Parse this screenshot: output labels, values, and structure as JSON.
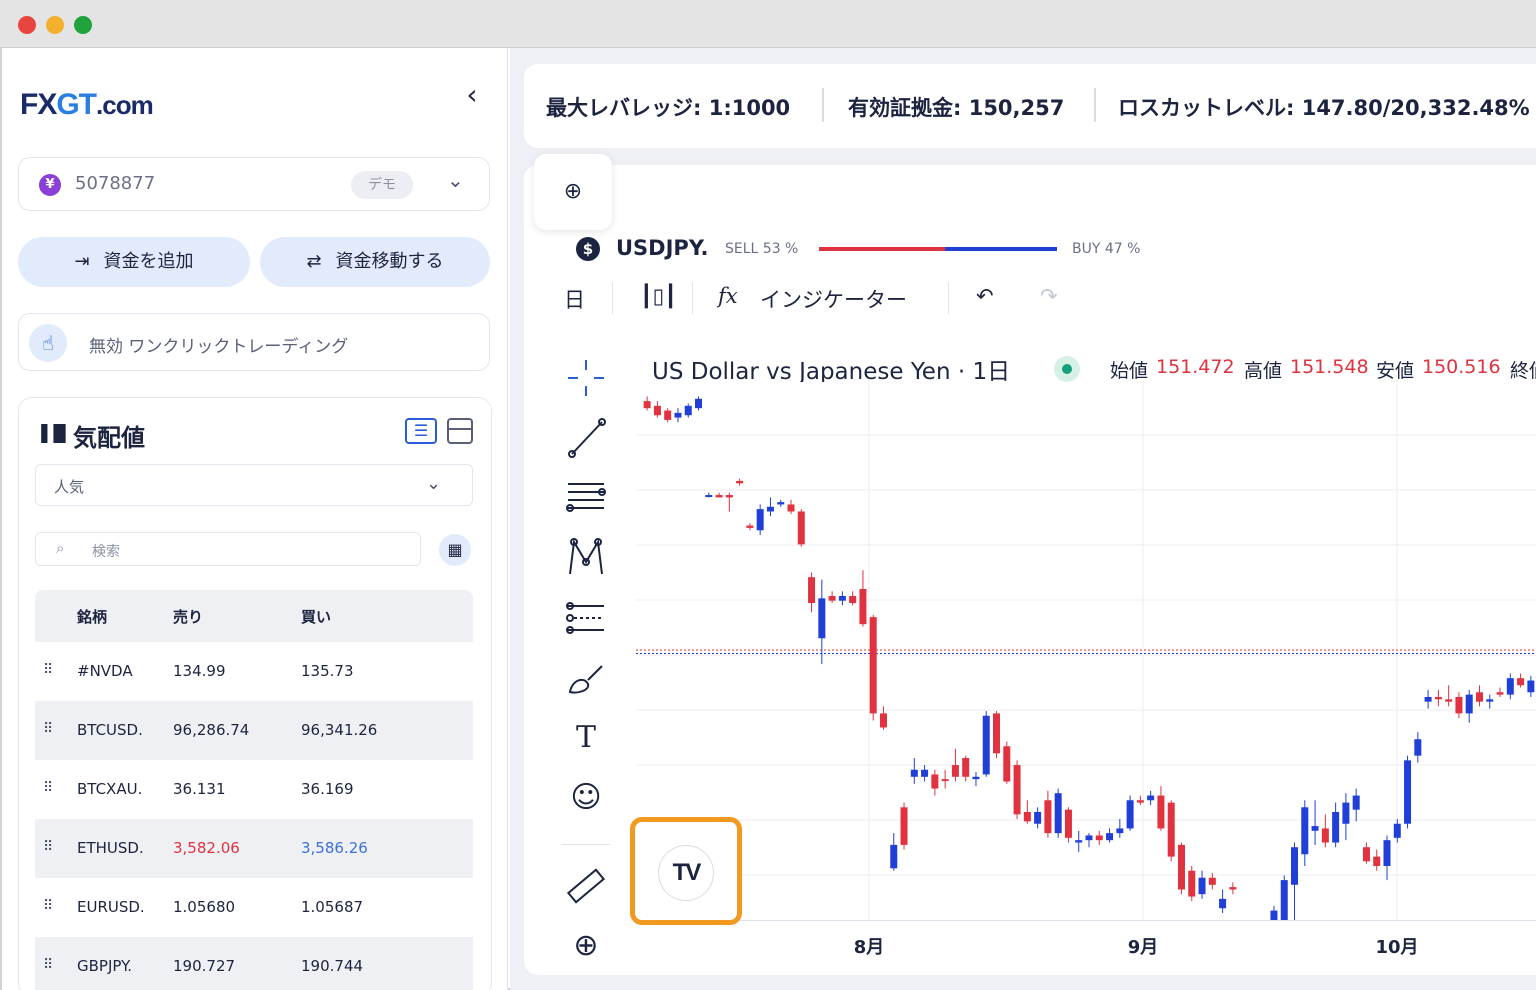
{
  "window": {
    "buttons": [
      "close",
      "minimize",
      "zoom"
    ]
  },
  "sidebar": {
    "logo": {
      "part1": "FX",
      "part2": "GT",
      "part3": ".com"
    },
    "collapse_icon": "chevron-left-icon",
    "account": {
      "number": "5078877",
      "badge": "デモ",
      "currency_icon": "¥"
    },
    "add_funds_label": "資金を追加",
    "transfer_label": "資金移動する",
    "one_click_label": "無効 ワンクリックトレーディング",
    "quotes": {
      "title": "気配値",
      "filter_value": "人気",
      "search_placeholder": "検索",
      "columns": [
        "銘柄",
        "売り",
        "買い"
      ],
      "rows": [
        {
          "symbol": "#NVDA",
          "sell": "134.99",
          "buy": "135.73"
        },
        {
          "symbol": "BTCUSD.",
          "sell": "96,286.74",
          "buy": "96,341.26"
        },
        {
          "symbol": "BTCXAU.",
          "sell": "36.131",
          "buy": "36.169"
        },
        {
          "symbol": "ETHUSD.",
          "sell": "3,582.06",
          "buy": "3,586.26"
        },
        {
          "symbol": "EURUSD.",
          "sell": "1.05680",
          "buy": "1.05687"
        },
        {
          "symbol": "GBPJPY.",
          "sell": "190.727",
          "buy": "190.744"
        }
      ]
    }
  },
  "infobar": {
    "max_leverage": "最大レバレッジ: 1:1000",
    "equity": "有効証拠金: 150,257",
    "stop_out": "ロスカットレベル: 147.80/20,332.48%"
  },
  "chart_header": {
    "symbol": "USDJPY.",
    "sell": "SELL 53 %",
    "buy": "BUY 47 %",
    "sell_pct": 53,
    "buy_pct": 47
  },
  "toolbar": {
    "interval": "日",
    "indicators_label": "インジケーター"
  },
  "legend": {
    "name": "US Dollar vs Japanese Yen · 1日",
    "open_label": "始値",
    "open": "151.472",
    "high_label": "高値",
    "high": "151.548",
    "low_label": "安値",
    "low": "150.516",
    "close_label": "終値"
  },
  "colors": {
    "up": "#1f3fd6",
    "down": "#e0323f",
    "accent": "#2a5ed6",
    "highlight": "#f29a20"
  },
  "chart_data": {
    "type": "candlestick",
    "x_ticks": [
      "8月",
      "9月",
      "10月"
    ],
    "ylim": [
      139.5,
      162.5
    ],
    "candles": [
      {
        "o": 161.6,
        "h": 161.8,
        "l": 161.2,
        "c": 161.3,
        "d": "down"
      },
      {
        "o": 161.4,
        "h": 161.6,
        "l": 160.9,
        "c": 161.0,
        "d": "down"
      },
      {
        "o": 161.2,
        "h": 161.3,
        "l": 160.7,
        "c": 160.8,
        "d": "down"
      },
      {
        "o": 160.9,
        "h": 161.3,
        "l": 160.7,
        "c": 161.1,
        "d": "up"
      },
      {
        "o": 161.0,
        "h": 161.5,
        "l": 160.9,
        "c": 161.4,
        "d": "up"
      },
      {
        "o": 161.3,
        "h": 161.8,
        "l": 161.2,
        "c": 161.7,
        "d": "up"
      },
      {
        "o": 157.6,
        "h": 157.7,
        "l": 157.5,
        "c": 157.6,
        "d": "up"
      },
      {
        "o": 157.6,
        "h": 157.7,
        "l": 157.5,
        "c": 157.5,
        "d": "down"
      },
      {
        "o": 157.6,
        "h": 157.7,
        "l": 156.9,
        "c": 157.5,
        "d": "down"
      },
      {
        "o": 158.2,
        "h": 158.3,
        "l": 158.0,
        "c": 158.1,
        "d": "down"
      },
      {
        "o": 156.3,
        "h": 156.4,
        "l": 156.1,
        "c": 156.2,
        "d": "down"
      },
      {
        "o": 156.1,
        "h": 157.2,
        "l": 155.9,
        "c": 157.0,
        "d": "up"
      },
      {
        "o": 156.9,
        "h": 157.5,
        "l": 156.7,
        "c": 157.1,
        "d": "up"
      },
      {
        "o": 157.3,
        "h": 157.4,
        "l": 157.1,
        "c": 157.2,
        "d": "up"
      },
      {
        "o": 157.2,
        "h": 157.4,
        "l": 156.8,
        "c": 156.9,
        "d": "down"
      },
      {
        "o": 156.9,
        "h": 157.0,
        "l": 155.4,
        "c": 155.5,
        "d": "down"
      },
      {
        "o": 154.1,
        "h": 154.3,
        "l": 152.6,
        "c": 153.0,
        "d": "down"
      },
      {
        "o": 151.5,
        "h": 154.0,
        "l": 150.4,
        "c": 153.2,
        "d": "up"
      },
      {
        "o": 153.3,
        "h": 153.5,
        "l": 153.0,
        "c": 153.1,
        "d": "down"
      },
      {
        "o": 153.1,
        "h": 153.5,
        "l": 152.9,
        "c": 153.3,
        "d": "up"
      },
      {
        "o": 153.3,
        "h": 153.5,
        "l": 152.9,
        "c": 153.0,
        "d": "down"
      },
      {
        "o": 153.6,
        "h": 154.4,
        "l": 152.0,
        "c": 152.1,
        "d": "down"
      },
      {
        "o": 152.4,
        "h": 152.5,
        "l": 148.0,
        "c": 148.3,
        "d": "down"
      },
      {
        "o": 148.3,
        "h": 148.6,
        "l": 147.6,
        "c": 147.7,
        "d": "down"
      },
      {
        "o": 142.7,
        "h": 143.2,
        "l": 141.6,
        "c": 141.7,
        "d": "up"
      },
      {
        "o": 144.3,
        "h": 144.5,
        "l": 142.5,
        "c": 142.7,
        "d": "down"
      },
      {
        "o": 145.9,
        "h": 146.4,
        "l": 145.3,
        "c": 145.6,
        "d": "up"
      },
      {
        "o": 145.6,
        "h": 146.1,
        "l": 145.4,
        "c": 145.9,
        "d": "up"
      },
      {
        "o": 145.7,
        "h": 145.9,
        "l": 144.8,
        "c": 145.1,
        "d": "down"
      },
      {
        "o": 145.5,
        "h": 145.9,
        "l": 145.1,
        "c": 145.5,
        "d": "down"
      },
      {
        "o": 146.1,
        "h": 146.8,
        "l": 145.4,
        "c": 145.6,
        "d": "down"
      },
      {
        "o": 146.4,
        "h": 146.5,
        "l": 145.4,
        "c": 145.6,
        "d": "down"
      },
      {
        "o": 145.5,
        "h": 145.8,
        "l": 145.2,
        "c": 145.6,
        "d": "up"
      },
      {
        "o": 145.7,
        "h": 148.4,
        "l": 145.6,
        "c": 148.2,
        "d": "up"
      },
      {
        "o": 148.3,
        "h": 148.4,
        "l": 146.4,
        "c": 146.6,
        "d": "down"
      },
      {
        "o": 146.9,
        "h": 147.1,
        "l": 145.3,
        "c": 145.4,
        "d": "down"
      },
      {
        "o": 146.1,
        "h": 146.3,
        "l": 143.8,
        "c": 144.0,
        "d": "down"
      },
      {
        "o": 144.1,
        "h": 144.6,
        "l": 143.6,
        "c": 143.7,
        "d": "down"
      },
      {
        "o": 143.6,
        "h": 144.3,
        "l": 143.4,
        "c": 144.1,
        "d": "up"
      },
      {
        "o": 144.6,
        "h": 145.0,
        "l": 143.0,
        "c": 143.2,
        "d": "down"
      },
      {
        "o": 143.2,
        "h": 145.1,
        "l": 143.0,
        "c": 144.9,
        "d": "up"
      },
      {
        "o": 144.2,
        "h": 144.3,
        "l": 142.8,
        "c": 143.0,
        "d": "down"
      },
      {
        "o": 142.8,
        "h": 143.3,
        "l": 142.4,
        "c": 142.9,
        "d": "up"
      },
      {
        "o": 142.9,
        "h": 143.2,
        "l": 142.6,
        "c": 143.1,
        "d": "up"
      },
      {
        "o": 143.1,
        "h": 143.3,
        "l": 142.7,
        "c": 142.9,
        "d": "down"
      },
      {
        "o": 142.9,
        "h": 143.4,
        "l": 142.8,
        "c": 143.2,
        "d": "up"
      },
      {
        "o": 143.2,
        "h": 143.8,
        "l": 143.0,
        "c": 143.4,
        "d": "up"
      },
      {
        "o": 143.4,
        "h": 144.8,
        "l": 143.3,
        "c": 144.6,
        "d": "up"
      },
      {
        "o": 144.6,
        "h": 144.8,
        "l": 144.4,
        "c": 144.5,
        "d": "down"
      },
      {
        "o": 144.6,
        "h": 145.0,
        "l": 144.4,
        "c": 144.8,
        "d": "up"
      },
      {
        "o": 144.8,
        "h": 145.2,
        "l": 143.3,
        "c": 143.4,
        "d": "down"
      },
      {
        "o": 144.5,
        "h": 144.6,
        "l": 142.0,
        "c": 142.2,
        "d": "down"
      },
      {
        "o": 142.7,
        "h": 142.8,
        "l": 140.6,
        "c": 140.8,
        "d": "down"
      },
      {
        "o": 141.6,
        "h": 141.8,
        "l": 140.3,
        "c": 140.5,
        "d": "down"
      },
      {
        "o": 140.6,
        "h": 141.6,
        "l": 140.4,
        "c": 141.3,
        "d": "up"
      },
      {
        "o": 141.3,
        "h": 141.5,
        "l": 140.8,
        "c": 141.0,
        "d": "down"
      },
      {
        "o": 140.4,
        "h": 140.8,
        "l": 139.8,
        "c": 140.0,
        "d": "up"
      },
      {
        "o": 140.8,
        "h": 141.1,
        "l": 140.6,
        "c": 140.9,
        "d": "down"
      },
      {
        "o": 139.4,
        "h": 139.5,
        "l": 139.0,
        "c": 139.4,
        "d": "up"
      },
      {
        "o": 139.4,
        "h": 139.5,
        "l": 139.0,
        "c": 139.3,
        "d": "up"
      },
      {
        "o": 139.0,
        "h": 139.4,
        "l": 138.9,
        "c": 139.2,
        "d": "down"
      },
      {
        "o": 139.0,
        "h": 140.1,
        "l": 138.8,
        "c": 139.9,
        "d": "up"
      },
      {
        "o": 139.4,
        "h": 141.4,
        "l": 139.2,
        "c": 141.2,
        "d": "up"
      },
      {
        "o": 141.0,
        "h": 142.8,
        "l": 138.9,
        "c": 142.6,
        "d": "up"
      },
      {
        "o": 142.3,
        "h": 144.6,
        "l": 141.8,
        "c": 144.3,
        "d": "up"
      },
      {
        "o": 143.3,
        "h": 144.6,
        "l": 142.7,
        "c": 143.5,
        "d": "up"
      },
      {
        "o": 143.4,
        "h": 144.0,
        "l": 142.6,
        "c": 142.8,
        "d": "down"
      },
      {
        "o": 142.8,
        "h": 144.5,
        "l": 142.6,
        "c": 144.1,
        "d": "up"
      },
      {
        "o": 143.6,
        "h": 144.9,
        "l": 142.9,
        "c": 144.5,
        "d": "up"
      },
      {
        "o": 144.2,
        "h": 145.1,
        "l": 143.7,
        "c": 144.8,
        "d": "up"
      },
      {
        "o": 142.6,
        "h": 142.8,
        "l": 141.9,
        "c": 142.0,
        "d": "down"
      },
      {
        "o": 142.2,
        "h": 142.5,
        "l": 141.6,
        "c": 141.8,
        "d": "down"
      },
      {
        "o": 141.8,
        "h": 143.1,
        "l": 141.2,
        "c": 142.9,
        "d": "up"
      },
      {
        "o": 143.0,
        "h": 143.8,
        "l": 142.8,
        "c": 143.6,
        "d": "up"
      },
      {
        "o": 143.6,
        "h": 146.5,
        "l": 143.4,
        "c": 146.3,
        "d": "up"
      },
      {
        "o": 146.5,
        "h": 147.5,
        "l": 146.2,
        "c": 147.2,
        "d": "up"
      },
      {
        "o": 148.8,
        "h": 149.3,
        "l": 148.5,
        "c": 149.0,
        "d": "up"
      },
      {
        "o": 149.0,
        "h": 149.3,
        "l": 148.6,
        "c": 148.9,
        "d": "down"
      },
      {
        "o": 148.9,
        "h": 149.5,
        "l": 148.6,
        "c": 148.8,
        "d": "down"
      },
      {
        "o": 149.0,
        "h": 149.2,
        "l": 148.1,
        "c": 148.3,
        "d": "down"
      },
      {
        "o": 148.3,
        "h": 149.3,
        "l": 147.9,
        "c": 149.1,
        "d": "up"
      },
      {
        "o": 149.2,
        "h": 149.5,
        "l": 148.6,
        "c": 148.8,
        "d": "down"
      },
      {
        "o": 148.8,
        "h": 149.1,
        "l": 148.5,
        "c": 148.9,
        "d": "up"
      },
      {
        "o": 149.2,
        "h": 149.4,
        "l": 149.0,
        "c": 149.1,
        "d": "down"
      },
      {
        "o": 149.1,
        "h": 150.0,
        "l": 148.9,
        "c": 149.8,
        "d": "up"
      },
      {
        "o": 149.8,
        "h": 150.0,
        "l": 149.4,
        "c": 149.5,
        "d": "down"
      },
      {
        "o": 149.2,
        "h": 149.9,
        "l": 149.0,
        "c": 149.7,
        "d": "up"
      }
    ],
    "hlines": [
      151.0,
      150.85
    ]
  }
}
